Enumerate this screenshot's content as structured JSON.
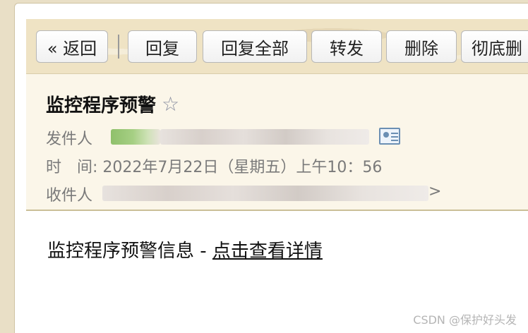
{
  "toolbar": {
    "back_label": "« 返回",
    "reply_label": "回复",
    "reply_all_label": "回复全部",
    "forward_label": "转发",
    "delete_label": "删除",
    "purge_label": "彻底删"
  },
  "mail": {
    "subject": "监控程序预警",
    "star": "☆",
    "sender_label": "发件人",
    "time_label": "时　间:",
    "time_value": "2022年7月22日（星期五）上午10：56",
    "recipient_label": "收件人",
    "recipient_tail": ">",
    "body_prefix": "监控程序预警信息 - ",
    "body_link": "点击查看详情"
  },
  "watermark": "CSDN @保护好头发"
}
